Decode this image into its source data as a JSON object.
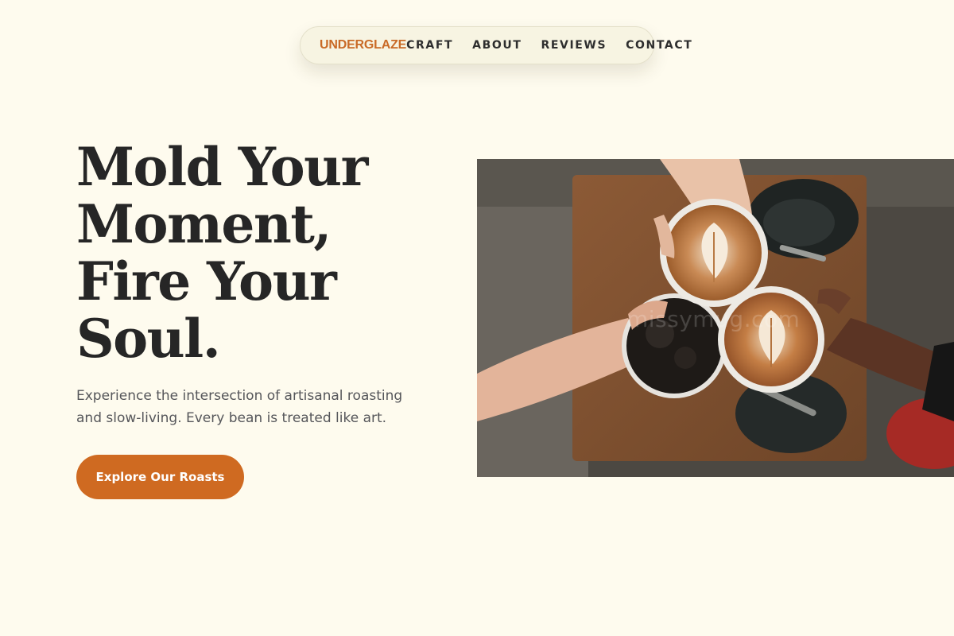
{
  "nav": {
    "brand": "UNDERGLAZE",
    "links": [
      {
        "label": "CRAFT"
      },
      {
        "label": "ABOUT"
      },
      {
        "label": "REVIEWS"
      },
      {
        "label": "CONTACT"
      }
    ]
  },
  "hero": {
    "title_lines": [
      "Mold Your",
      "Moment,",
      "Fire Your",
      "Soul."
    ],
    "subtitle": "Experience the intersection of artisanal roasting and slow-living. Every bean is treated like art.",
    "cta_label": "Explore Our Roasts"
  },
  "image": {
    "watermark": "missymug.com",
    "subject": "three hands toasting cups of latte and iced coffee over a wooden table"
  },
  "colors": {
    "background": "#FEFBEE",
    "accent": "#CF6A21",
    "brand": "#C96A26",
    "text": "#262626",
    "muted_text": "#55565A"
  }
}
